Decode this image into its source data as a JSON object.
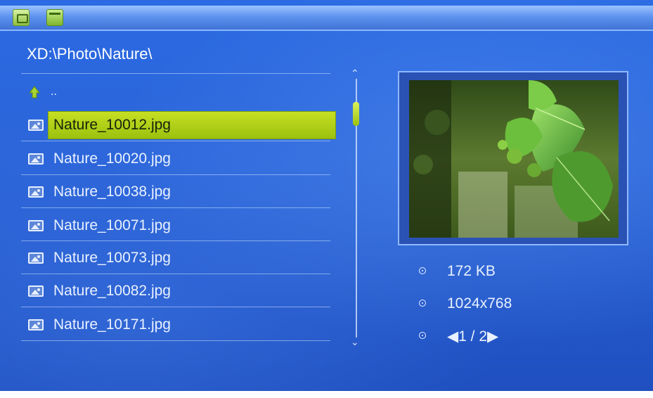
{
  "path": "XD:\\Photo\\Nature\\",
  "parent_label": "..",
  "files": [
    {
      "name": "Nature_10012.jpg",
      "selected": true
    },
    {
      "name": "Nature_10020.jpg",
      "selected": false
    },
    {
      "name": "Nature_10038.jpg",
      "selected": false
    },
    {
      "name": "Nature_10071.jpg",
      "selected": false
    },
    {
      "name": "Nature_10073.jpg",
      "selected": false
    },
    {
      "name": "Nature_10082.jpg",
      "selected": false
    },
    {
      "name": "Nature_10171.jpg",
      "selected": false
    }
  ],
  "info": {
    "size": "172 KB",
    "resolution": "1024x768",
    "page": "◀1 / 2▶"
  },
  "icons": {
    "toolbar_left": "photo-icon",
    "toolbar_right": "folder-icon",
    "parent": "up-arrow-icon",
    "file": "image-file-icon"
  },
  "colors": {
    "selection": "#b5d41a",
    "background": "#2a63d8"
  }
}
